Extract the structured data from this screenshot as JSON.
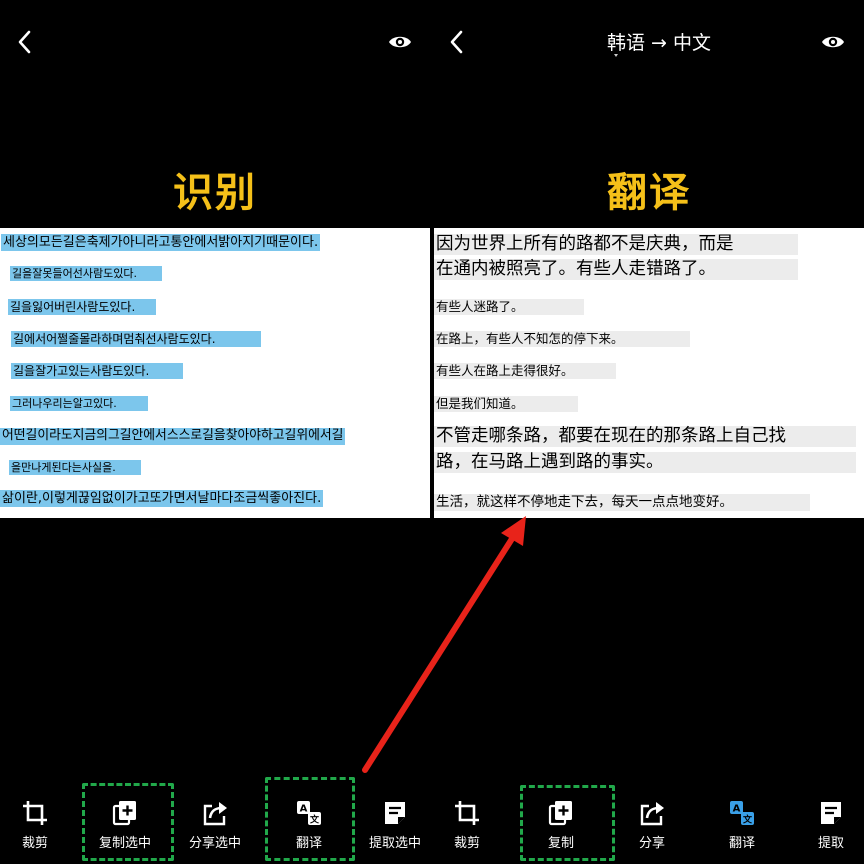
{
  "left": {
    "heading": "识别",
    "korean_lines": [
      "세상의모든길은축제가아니라고통안에서밝아지기때문이다.",
      "길을잘못들어선사람도있다.",
      "길을잃어버린사람도있다.",
      "길에서어쩔줄몰라하며멈춰선사람도있다.",
      "길을잘가고있는사람도있다.",
      "그러나우리는알고있다.",
      "어떤길이라도지금의그길안에서스스로길을찾아야하고길위에서길",
      "을만나게된다는사실을.",
      "삶이란,이렇게끊임없이가고또가면서날마다조금씩좋아진다."
    ],
    "toolbar": [
      {
        "label": "裁剪",
        "icon": "crop-icon"
      },
      {
        "label": "复制选中",
        "icon": "copy-add-icon"
      },
      {
        "label": "分享选中",
        "icon": "share-icon"
      },
      {
        "label": "翻译",
        "icon": "translate-icon"
      },
      {
        "label": "提取选中",
        "icon": "extract-icon"
      }
    ]
  },
  "right": {
    "language_selector": "韩语 → 中文",
    "heading": "翻译",
    "chinese_lines": [
      "因为世界上所有的路都不是庆典，而是",
      "在通内被照亮了。有些人走错路了。",
      "有些人迷路了。",
      "在路上，有些人不知怎的停下来。",
      "有些人在路上走得很好。",
      "但是我们知道。",
      "不管走哪条路，都要在现在的那条路上自己找",
      "路，在马路上遇到路的事实。",
      "生活，就这样不停地走下去，每天一点点地变好。"
    ],
    "toolbar": [
      {
        "label": "裁剪",
        "icon": "crop-icon"
      },
      {
        "label": "复制",
        "icon": "copy-add-icon"
      },
      {
        "label": "分享",
        "icon": "share-icon"
      },
      {
        "label": "翻译",
        "icon": "translate-icon"
      },
      {
        "label": "提取",
        "icon": "extract-icon"
      }
    ]
  },
  "colors": {
    "heading": "#f5c019",
    "korean_highlight": "#7cc6ec",
    "annotation_box": "#21a84a",
    "arrow": "#e8231a",
    "active_icon": "#3aa0e8"
  }
}
